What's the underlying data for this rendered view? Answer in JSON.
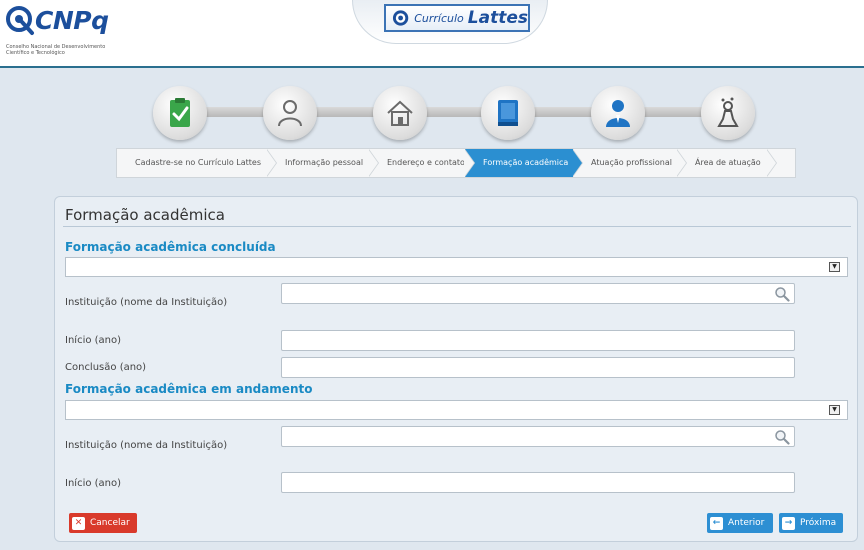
{
  "header": {
    "logo_text": "CNPq",
    "logo_subtitle_1": "Conselho Nacional de Desenvolvimento",
    "logo_subtitle_2": "Científico e Tecnológico",
    "app_label": "Currículo",
    "app_strong": "Lattes"
  },
  "steps": [
    {
      "icon": "clipboard-check-icon"
    },
    {
      "icon": "user-icon"
    },
    {
      "icon": "house-icon"
    },
    {
      "icon": "book-icon"
    },
    {
      "icon": "person-suit-icon"
    },
    {
      "icon": "person-flask-icon"
    }
  ],
  "breadcrumb": [
    {
      "label": "Cadastre-se no Currículo Lattes",
      "active": false
    },
    {
      "label": "Informação pessoal",
      "active": false
    },
    {
      "label": "Endereço e contato",
      "active": false
    },
    {
      "label": "Formação acadêmica",
      "active": true
    },
    {
      "label": "Atuação profissional",
      "active": false
    },
    {
      "label": "Área de atuação",
      "active": false
    }
  ],
  "form": {
    "title": "Formação acadêmica",
    "completed": {
      "section_title": "Formação acadêmica concluída",
      "select_value": "",
      "institution_label": "Instituição (nome da Instituição)",
      "institution_value": "",
      "start_label": "Início (ano)",
      "start_value": "",
      "end_label": "Conclusão (ano)",
      "end_value": ""
    },
    "ongoing": {
      "section_title": "Formação acadêmica em andamento",
      "select_value": "",
      "institution_label": "Instituição (nome da Instituição)",
      "institution_value": "",
      "start_label": "Início (ano)",
      "start_value": ""
    },
    "buttons": {
      "cancel": "Cancelar",
      "previous": "Anterior",
      "next": "Próxima"
    }
  },
  "colors": {
    "accent": "#2b8fd1",
    "section_title": "#1a8ac4",
    "cancel": "#d93a2b",
    "brand": "#1c4f9c",
    "step_icon_green": "#3aa64a",
    "step_icon_blue": "#1f74c4"
  }
}
